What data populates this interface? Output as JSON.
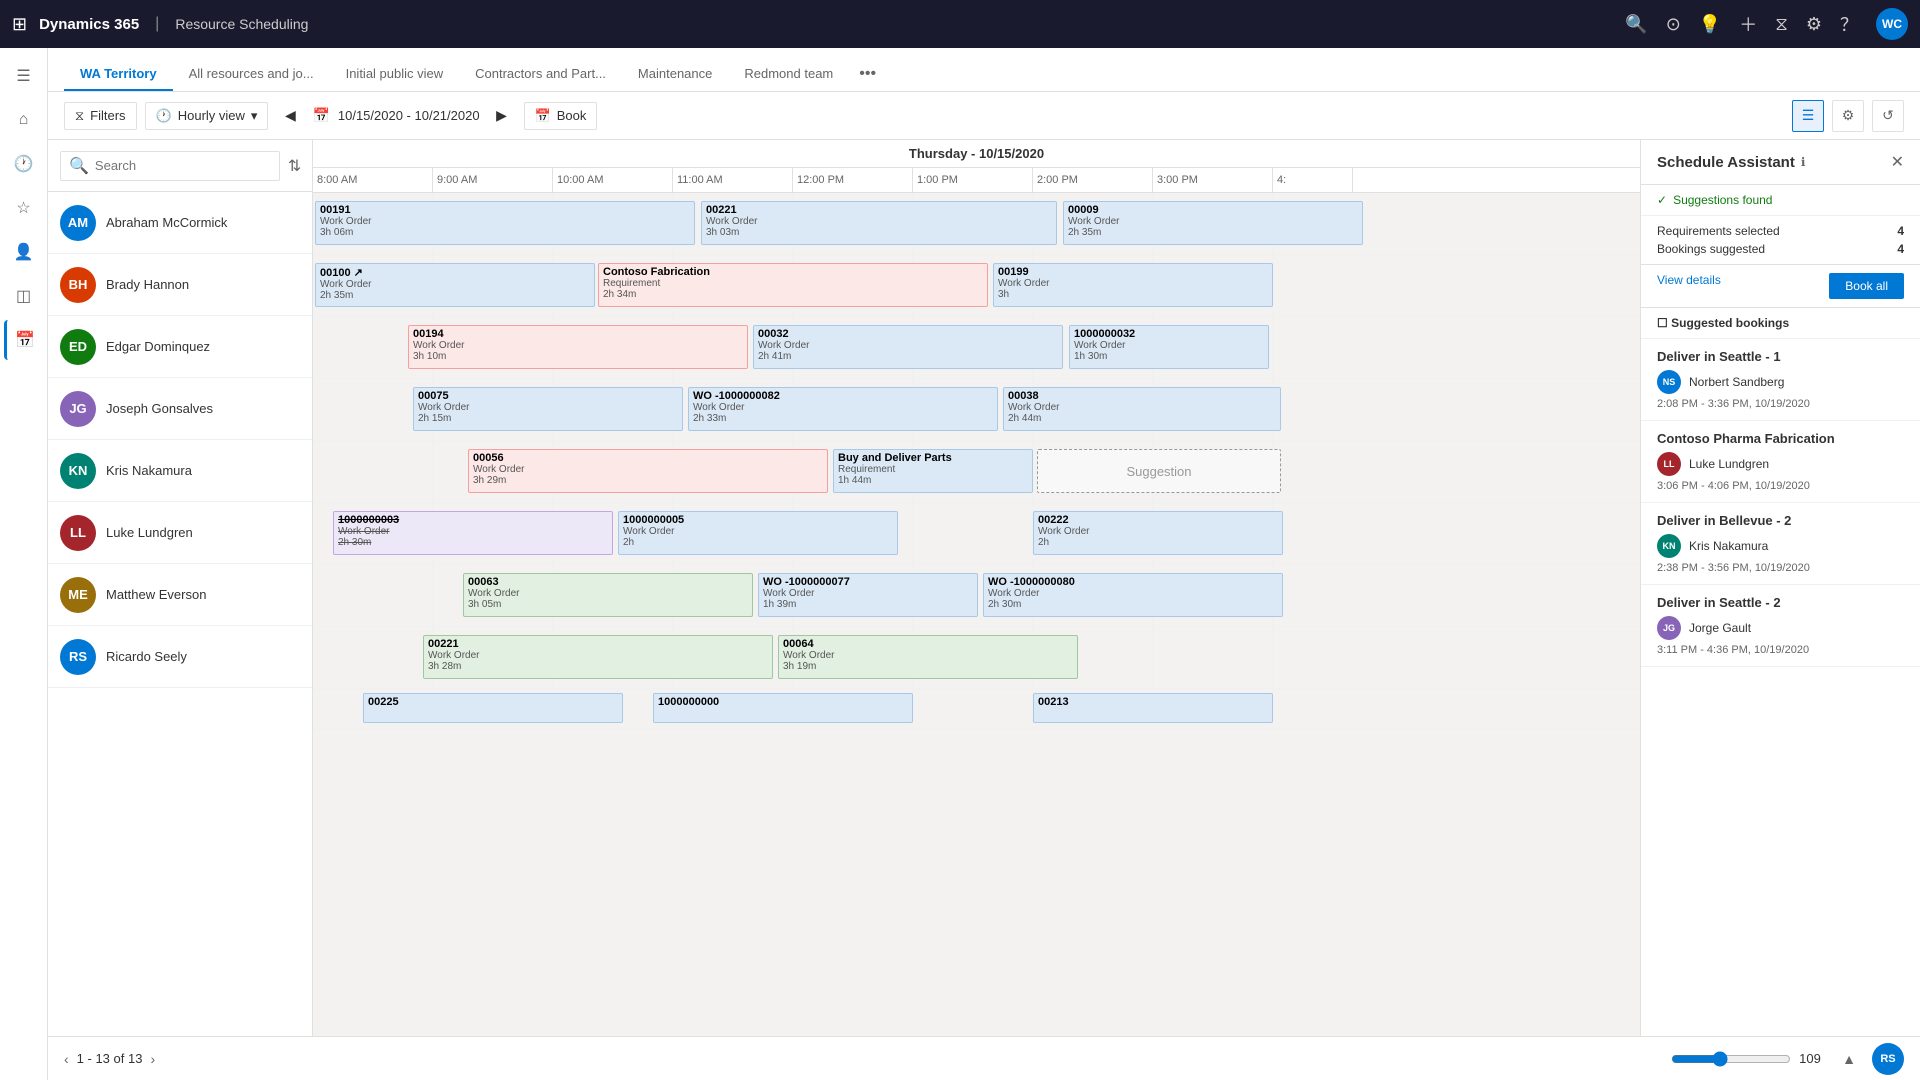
{
  "app": {
    "brand": "Dynamics 365",
    "divider": "|",
    "module": "Resource Scheduling",
    "user_initials": "WC"
  },
  "tabs": [
    {
      "label": "WA Territory",
      "active": true
    },
    {
      "label": "All resources and jo...",
      "active": false
    },
    {
      "label": "Initial public view",
      "active": false
    },
    {
      "label": "Contractors and Part...",
      "active": false
    },
    {
      "label": "Maintenance",
      "active": false
    },
    {
      "label": "Redmond team",
      "active": false
    }
  ],
  "toolbar": {
    "filters_label": "Filters",
    "hourly_view_label": "Hourly view",
    "date_range": "10/15/2020 - 10/21/2020",
    "book_label": "Book"
  },
  "search": {
    "placeholder": "Search"
  },
  "date_header": "Thursday - 10/15/2020",
  "time_slots": [
    "8:00 AM",
    "9:00 AM",
    "10:00 AM",
    "11:00 AM",
    "12:00 PM",
    "1:00 PM",
    "2:00 PM",
    "3:00 PM",
    "4:"
  ],
  "resources": [
    {
      "name": "Abraham McCormick",
      "initials": "AM",
      "color": "av-blue"
    },
    {
      "name": "Brady Hannon",
      "initials": "BH",
      "color": "av-orange"
    },
    {
      "name": "Edgar Dominquez",
      "initials": "ED",
      "color": "av-green"
    },
    {
      "name": "Joseph Gonsalves",
      "initials": "JG",
      "color": "av-purple"
    },
    {
      "name": "Kris Nakamura",
      "initials": "KN",
      "color": "av-teal"
    },
    {
      "name": "Luke Lundgren",
      "initials": "LL",
      "color": "av-red"
    },
    {
      "name": "Matthew Everson",
      "initials": "ME",
      "color": "av-yellow"
    },
    {
      "name": "Ricardo Seely",
      "initials": "RS",
      "color": "av-rs"
    }
  ],
  "schedule_assistant": {
    "title": "Schedule Assistant",
    "close_icon": "✕",
    "status": "Suggestions found",
    "requirements_selected_label": "Requirements selected",
    "requirements_selected_value": "4",
    "bookings_suggested_label": "Bookings suggested",
    "bookings_suggested_value": "4",
    "view_details_label": "View details",
    "book_all_label": "Book all",
    "suggested_bookings_label": "Suggested bookings",
    "bookings": [
      {
        "name": "Deliver in Seattle - 1",
        "person": "Norbert Sandberg",
        "initials": "NS",
        "color": "av-blue",
        "time": "2:08 PM - 3:36 PM, 10/19/2020"
      },
      {
        "name": "Contoso Pharma Fabrication",
        "person": "Luke Lundgren",
        "initials": "LL",
        "color": "av-red",
        "time": "3:06 PM - 4:06 PM, 10/19/2020"
      },
      {
        "name": "Deliver in Bellevue - 2",
        "person": "Kris Nakamura",
        "initials": "KN",
        "color": "av-teal",
        "time": "2:38 PM - 3:56 PM, 10/19/2020"
      },
      {
        "name": "Deliver in Seattle - 2",
        "person": "Jorge Gault",
        "initials": "JG",
        "color": "av-purple",
        "time": "3:11 PM - 4:36 PM, 10/19/2020"
      }
    ]
  },
  "pagination": {
    "current": "1 - 13 of 13"
  },
  "zoom": {
    "value": "109"
  },
  "sidebar_icons": [
    "☰",
    "⌂",
    "≡",
    "☆",
    "◎",
    "📋",
    "◫"
  ],
  "bottom_initials": "RS"
}
